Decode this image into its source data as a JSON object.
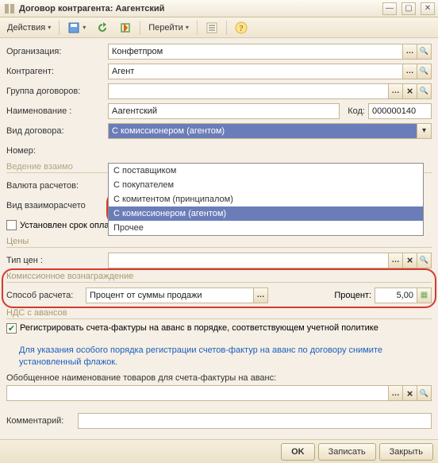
{
  "window": {
    "title": "Договор контрагента: Аагентский"
  },
  "toolbar": {
    "actions_label": "Действия",
    "goto_label": "Перейти"
  },
  "fields": {
    "org_label": "Организация:",
    "org_value": "Конфетпром",
    "kontr_label": "Контрагент:",
    "kontr_value": "Агент",
    "group_label": "Группа договоров:",
    "group_value": "",
    "name_label": "Наименование :",
    "name_value": "Аагентский",
    "code_label": "Код:",
    "code_value": "000000140",
    "vid_label": "Вид договора:",
    "vid_value": "С комиссионером (агентом)",
    "nomer_label": "Номер:",
    "nomer_value": ""
  },
  "vid_options": [
    "С поставщиком",
    "С покупателем",
    "С комитентом (принципалом)",
    "С комиссионером (агентом)",
    "Прочее"
  ],
  "sections": {
    "vzaimo": "Ведение взаимо",
    "ceny": "Цены",
    "komiss": "Комиссионное вознаграждение",
    "nds": "НДС с авансов"
  },
  "vzaimo": {
    "valuta_label": "Валюта расчетов:",
    "vid_vzaim_label": "Вид взаиморасчето",
    "srok_check_label": "Установлен срок оплаты по договору",
    "srok_checked": false
  },
  "ceny": {
    "tip_label": "Тип цен :",
    "tip_value": ""
  },
  "komiss": {
    "sposob_label": "Способ расчета:",
    "sposob_value": "Процент от суммы продажи",
    "procent_label": "Процент:",
    "procent_value": "5,00"
  },
  "nds": {
    "reg_checked": true,
    "reg_label": "Регистрировать счета-фактуры на аванс в порядке, соответствующем учетной политике",
    "hint": "Для указания особого порядка регистрации счетов-фактур на аванс по договору снимите установленный флажок.",
    "obob_label": "Обобщенное наименование товаров для счета-фактуры на аванс:",
    "obob_value": "",
    "comment_label": "Комментарий:",
    "comment_value": ""
  },
  "footer": {
    "ok": "OK",
    "save": "Записать",
    "close": "Закрыть"
  }
}
